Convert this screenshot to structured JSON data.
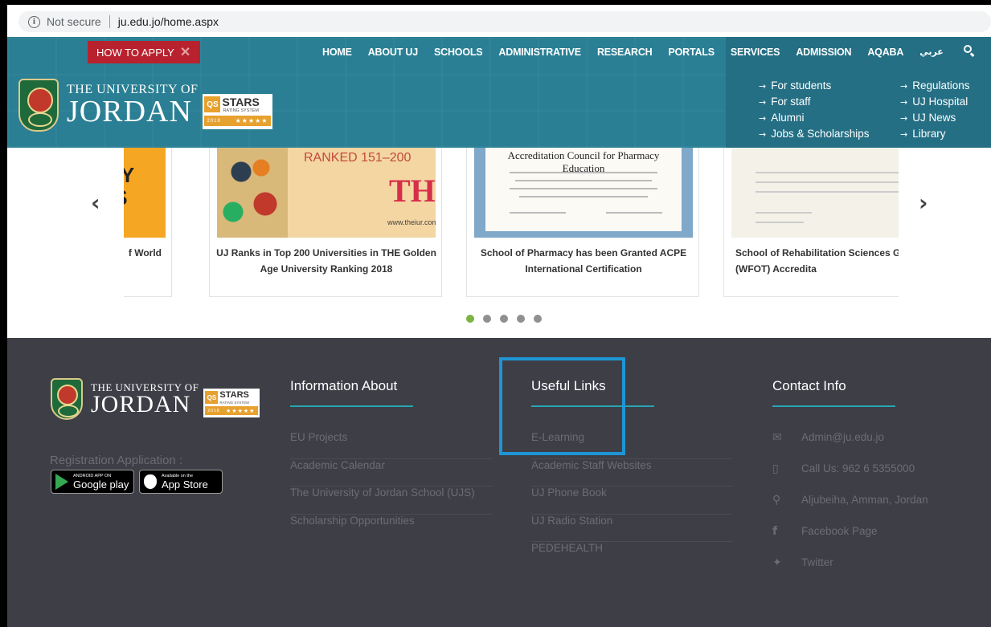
{
  "browser": {
    "security_label": "Not secure",
    "url": "ju.edu.jo/home.aspx",
    "info_icon": "info-icon"
  },
  "header": {
    "how_to_apply": "HOW TO APPLY",
    "nav": [
      "HOME",
      "ABOUT UJ",
      "SCHOOLS",
      "ADMINISTRATIVE",
      "RESEARCH",
      "PORTALS",
      "SERVICES",
      "ADMISSION",
      "AQABA",
      "عربي"
    ],
    "logo": {
      "line1": "THE UNIVERSITY OF",
      "line2": "JORDAN",
      "qs_box": "QS",
      "qs_stars": "STARS",
      "qs_rating": "RATING SYSTEM",
      "qs_year": "2018",
      "qs_star_glyphs": "★★★★★"
    },
    "quick_links_left": [
      "For students",
      "For staff",
      "Alumni",
      "Jobs & Scholarships"
    ],
    "quick_links_right": [
      "Regulations",
      "UJ Hospital",
      "UJ News",
      "Library"
    ],
    "accent": "#2a7f94",
    "apply_color": "#b8222e"
  },
  "slider": {
    "cards": [
      {
        "caption": "f World",
        "image_text": "TY\nIS"
      },
      {
        "caption": "UJ Ranks in Top 200 Universities in THE Golden Age University Ranking 2018",
        "ranked": "RANKED 151–200",
        "the_logo": "THE",
        "site": "www.theiur.com"
      },
      {
        "caption": "School of Pharmacy has been Granted ACPE International Certification",
        "certificate_title": "Accreditation Council for Pharmacy Education"
      },
      {
        "caption": "School of Rehabilitation Sciences Granted (WFOT) Accredita"
      }
    ],
    "dots": 5,
    "active_dot": 0,
    "dot_active_color": "#7cb342"
  },
  "footer": {
    "logo": {
      "line1": "THE UNIVERSITY OF",
      "line2": "JORDAN",
      "qs_box": "QS",
      "qs_stars": "STARS",
      "qs_rating": "RATING SYSTEM",
      "qs_year": "2018",
      "qs_star_glyphs": "★★★★★"
    },
    "registration_label": "Registration Application :",
    "google_play": {
      "small": "ANDROID APP ON",
      "big": "Google play"
    },
    "app_store": {
      "small": "Available on the",
      "big": "App Store"
    },
    "info_about": {
      "heading": "Information About",
      "items": [
        "EU Projects",
        "Academic Calendar",
        "The University of Jordan School (UJS)",
        "Scholarship Opportunities"
      ]
    },
    "useful_links": {
      "heading": "Useful Links",
      "items": [
        "E-Learning",
        "Academic Staff Websites",
        "UJ Phone Book",
        "UJ Radio Station",
        "PEDEHEALTH"
      ]
    },
    "contact": {
      "heading": "Contact Info",
      "rows": [
        {
          "icon": "envelope-icon",
          "glyph": "✉",
          "text": "Admin@ju.edu.jo"
        },
        {
          "icon": "phone-icon",
          "glyph": "▯",
          "text": "Call Us: 962 6 5355000"
        },
        {
          "icon": "location-pin-icon",
          "glyph": "⚲",
          "text": "Aljubeiha, Amman, Jordan"
        },
        {
          "icon": "facebook-icon",
          "glyph": "f",
          "text": "Facebook Page"
        },
        {
          "icon": "twitter-icon",
          "glyph": "✦",
          "text": "Twitter"
        }
      ]
    },
    "highlight_color": "#1e95d4"
  }
}
